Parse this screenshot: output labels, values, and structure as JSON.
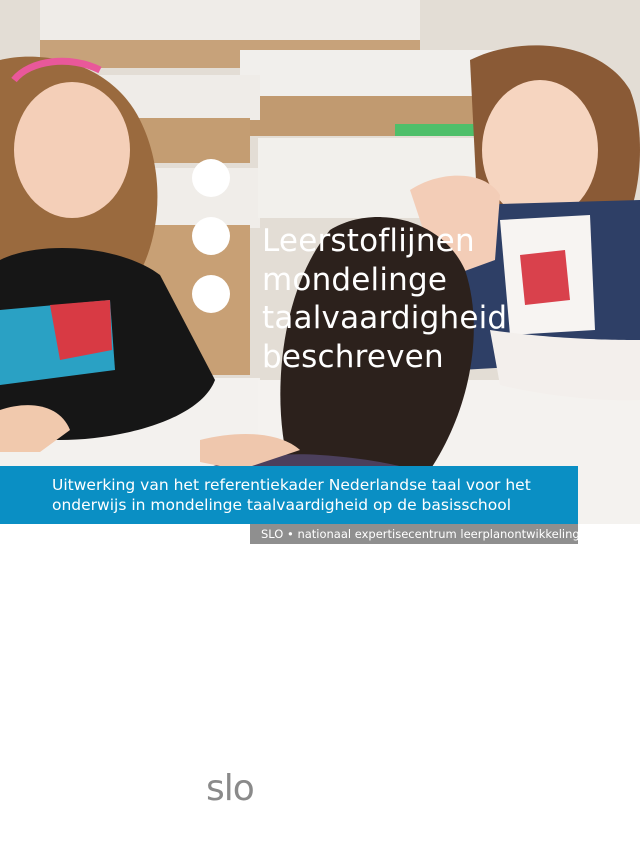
{
  "cover": {
    "title_lines": [
      "Leerstoflijnen",
      "mondelinge",
      "taalvaardigheid",
      "beschreven"
    ],
    "subtitle_lines": [
      "Uitwerking van het referentiekader Nederlandse taal voor het",
      "onderwijs in mondelinge taalvaardigheid op de basisschool"
    ],
    "organization": "SLO • nationaal expertisecentrum leerplanontwikkeling",
    "logo": "slo"
  },
  "colors": {
    "band": "#0a8fc4",
    "org_bar": "#8f8f8f",
    "logo": "#8a8a8a"
  }
}
